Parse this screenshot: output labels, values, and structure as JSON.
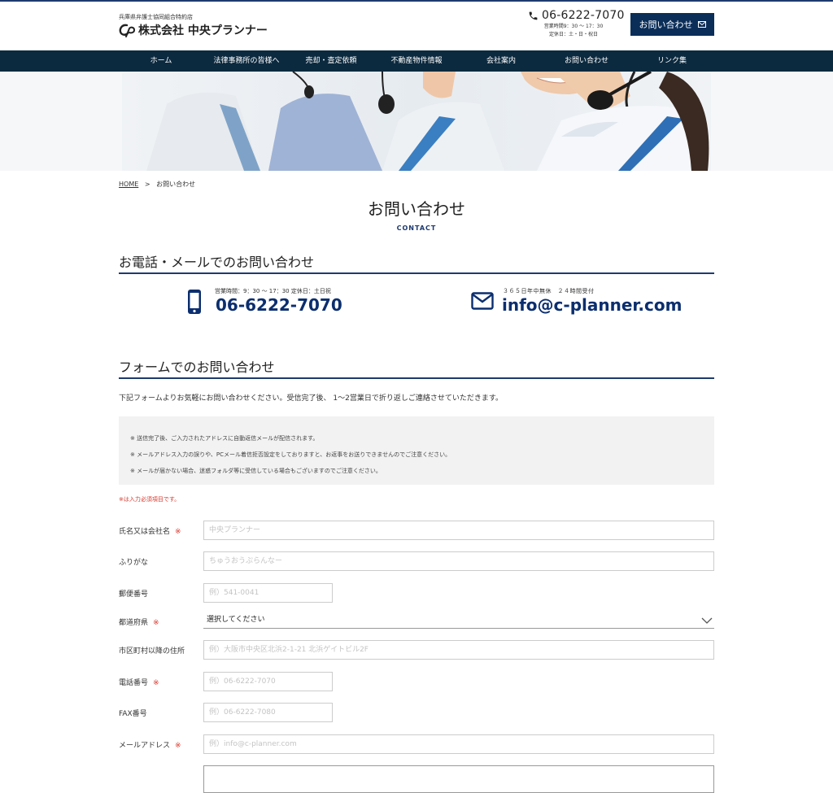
{
  "header": {
    "logo_sub": "兵庫県弁護士協同組合特約店",
    "logo_name": "株式会社 中央プランナー",
    "phone": "06-6222-7070",
    "hours_line1": "営業時間9：30 〜 17：30",
    "hours_line2": "定休日：土・日・祝日",
    "contact_button": "お問い合わせ"
  },
  "nav": {
    "items": [
      {
        "label": "ホーム"
      },
      {
        "label": "法律事務所の皆様へ"
      },
      {
        "label": "売却・査定依頼"
      },
      {
        "label": "不動産物件情報"
      },
      {
        "label": "会社案内"
      },
      {
        "label": "お問い合わせ"
      },
      {
        "label": "リンク集"
      }
    ]
  },
  "breadcrumb": {
    "home": "HOME",
    "sep": ">",
    "current": "お問い合わせ"
  },
  "page": {
    "title": "お問い合わせ",
    "subtitle": "CONTACT"
  },
  "contact_section": {
    "heading": "お電話・メールでのお問い合わせ",
    "phone_hours": "営業時間：9：30 〜 17：30 定休日：土日祝",
    "phone_number": "06-6222-7070",
    "mail_hours": "３６５日年中無休　２４時間受付",
    "mail_address": "info@c-planner.com"
  },
  "form_section": {
    "heading": "フォームでのお問い合わせ",
    "intro": "下記フォームよりお気軽にお問い合わせください。受信完了後、 1～2営業日で折り返しご連絡させていただきます。",
    "notes": [
      "※ 送信完了後、ご入力されたアドレスに自動返信メールが配信されます。",
      "※ メールアドレス入力の誤りや、PCメール着信拒否設定をしておりますと、お返事をお送りできませんのでご注意ください。",
      "※ メールが届かない場合、迷惑フォルダ等に受信している場合もございますのでご注意ください。"
    ],
    "required_note": "※は入力必須項目です。",
    "required_mark": "※",
    "fields": {
      "name": {
        "label": "氏名又は会社名",
        "placeholder": "中央プランナー"
      },
      "kana": {
        "label": "ふりがな",
        "placeholder": "ちゅうおうぷらんなー"
      },
      "zip": {
        "label": "郵便番号",
        "placeholder": "例）541-0041"
      },
      "prefecture": {
        "label": "都道府県",
        "value": "選択してください"
      },
      "address": {
        "label": "市区町村以降の住所",
        "placeholder": "例）大阪市中央区北浜2-1-21 北浜ゲイトビル2F"
      },
      "tel": {
        "label": "電話番号",
        "placeholder": "例）06-6222-7070"
      },
      "fax": {
        "label": "FAX番号",
        "placeholder": "例）06-6222-7080"
      },
      "email": {
        "label": "メールアドレス",
        "placeholder": "例）info@c-planner.com"
      }
    }
  },
  "colors": {
    "navy": "#0b2e59",
    "nav_bar": "#0c2a3f",
    "accent_blue": "#1e3a6e",
    "required_red": "#d9362b",
    "notes_bg": "#f2f2f2"
  },
  "icons": [
    "phone-icon",
    "mail-icon",
    "smartphone-icon",
    "chevron-down-icon",
    "logo-mark"
  ]
}
